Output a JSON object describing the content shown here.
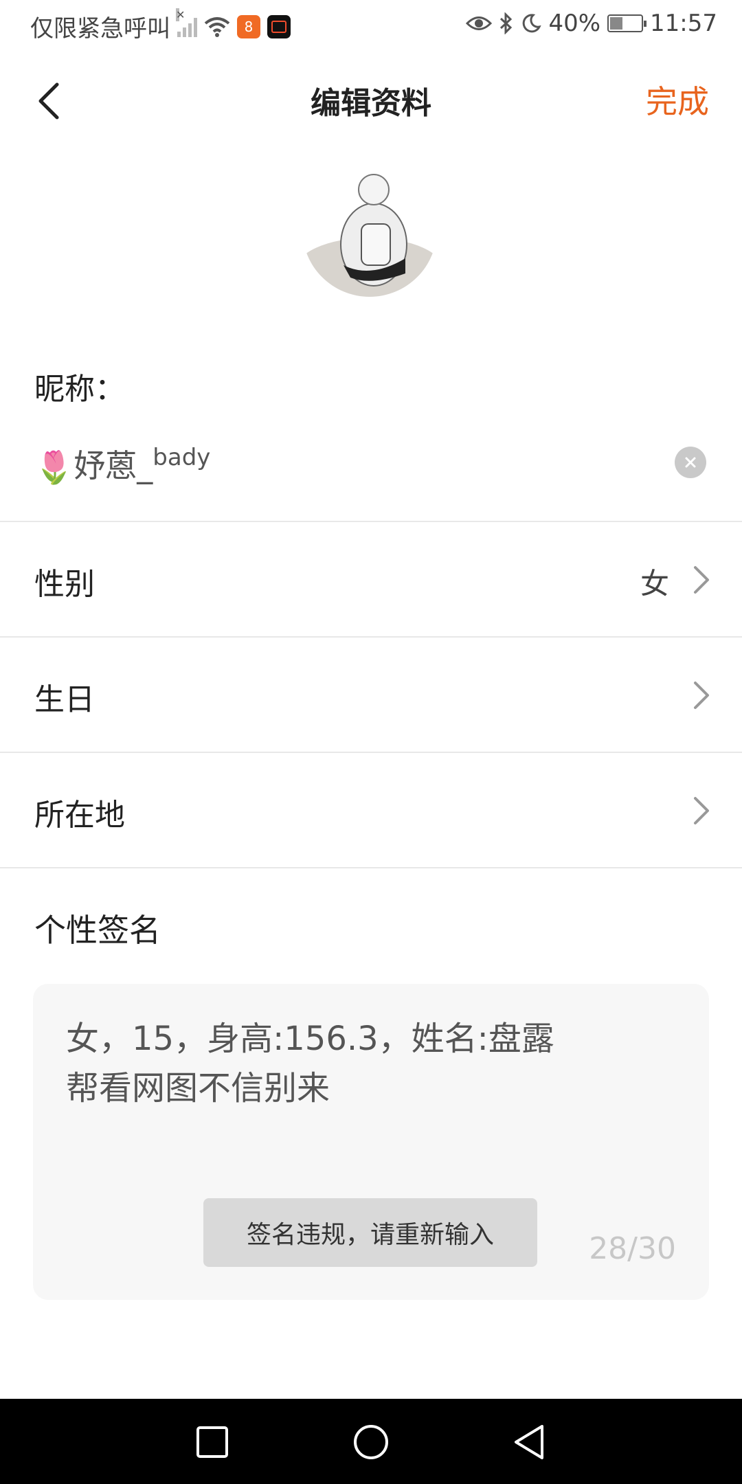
{
  "status_bar": {
    "carrier_text": "仅限紧急呼叫",
    "battery_percent": "40%",
    "battery_level": 0.4,
    "time": "11:57",
    "icons": [
      "signal-icon",
      "wifi-icon",
      "app-icon-orange",
      "app-icon-dark",
      "eye-icon",
      "bluetooth-icon",
      "moon-icon",
      "battery-icon"
    ]
  },
  "header": {
    "title": "编辑资料",
    "done_label": "完成",
    "accent_color": "#e8641e"
  },
  "profile": {
    "nickname_label": "昵称：",
    "nickname_emoji": "🌷",
    "nickname_main": "妤蒽_",
    "nickname_small": "bady"
  },
  "rows": {
    "gender": {
      "label": "性别",
      "value": "女"
    },
    "birthday": {
      "label": "生日"
    },
    "location": {
      "label": "所在地"
    }
  },
  "signature": {
    "label": "个性签名",
    "text_line1": "女，15，身高:156.3，姓名:盘露",
    "text_line2": "帮看网图不信别来",
    "toast": "签名违规，请重新输入",
    "counter": "28/30"
  },
  "nav_bar": {
    "buttons": [
      "recent-apps-button",
      "home-button",
      "back-nav-button"
    ]
  }
}
